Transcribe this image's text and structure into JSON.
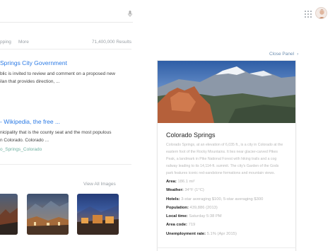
{
  "tabs": {
    "shopping": "pping",
    "more": "More",
    "result_count": "71,400,000 Results"
  },
  "results": [
    {
      "title": "Springs City Government",
      "snippet_lines": [
        "blic is invited to review and comment on a proposed new",
        "ilan that provides direction, ..."
      ],
      "url": ""
    },
    {
      "title": "- Wikipedia, the free ...",
      "snippet_lines": [
        "nicipality that is the county seat and the most populous",
        "n Colorado. Colorado ..."
      ],
      "url": "o_Springs_Colorado"
    }
  ],
  "images": {
    "view_all": "View All Images"
  },
  "panel": {
    "close_label": "Close Panel",
    "close_icon": "chevron-right-icon",
    "title": "Colorado Springs",
    "description_lines": [
      "Colorado Springs, at an elevation of 6,035 ft., is a city in Colorado at the",
      "eastern foot of the Rocky Mountains. It lies near glacier-carved Pikes",
      "Peak, a landmark in Pike National Forest with hiking trails and a cog",
      "railway leading to its 14,114-ft. summit. The city's Garden of the Gods",
      "park features iconic red-sandstone formations and mountain views."
    ],
    "facts": [
      {
        "label": "Area:",
        "value": "186.1 mi²"
      },
      {
        "label": "Weather:",
        "value": "34°F (1°C)"
      },
      {
        "label": "Hotels:",
        "value": "3-star averaging $100, 5-star averaging $300"
      },
      {
        "label": "Population:",
        "value": "439,886 (2013)"
      },
      {
        "label": "Local time:",
        "value": "Saturday 5:38 PM"
      },
      {
        "label": "Area code:",
        "value": "719"
      },
      {
        "label": "Unemployment rate:",
        "value": "5.1% (Apr 2015)"
      }
    ]
  },
  "header": {
    "apps_icon": "apps-grid-icon",
    "mic_icon": "microphone-icon",
    "avatar_icon": "user-avatar"
  }
}
